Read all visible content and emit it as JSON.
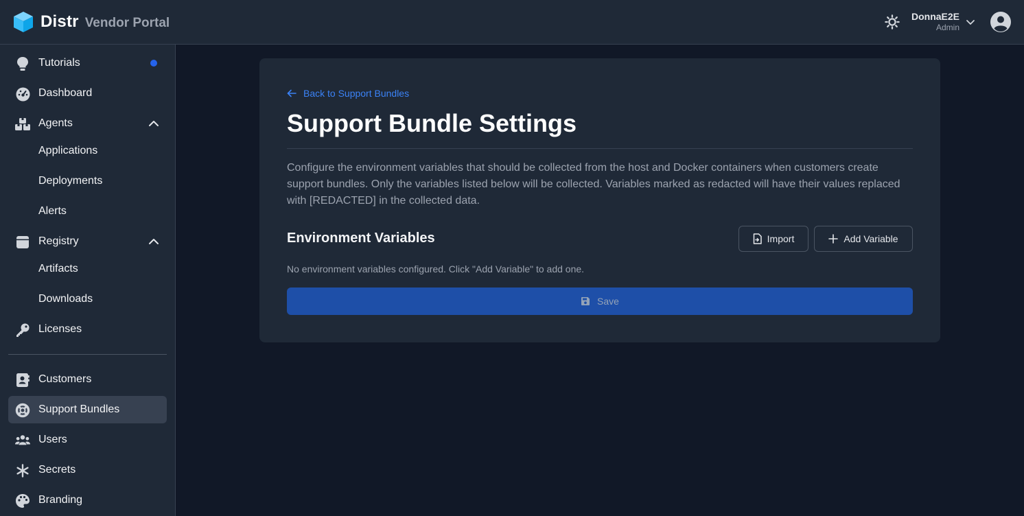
{
  "header": {
    "brand_name": "Distr",
    "brand_sub": "Vendor Portal",
    "user_name": "DonnaE2E",
    "user_role": "Admin"
  },
  "sidebar": {
    "items": [
      {
        "label": "Tutorials",
        "icon": "lightbulb-icon"
      },
      {
        "label": "Dashboard",
        "icon": "dashboard-icon"
      },
      {
        "label": "Agents",
        "icon": "agents-icon"
      },
      {
        "label": "Applications"
      },
      {
        "label": "Deployments"
      },
      {
        "label": "Alerts"
      },
      {
        "label": "Registry",
        "icon": "registry-icon"
      },
      {
        "label": "Artifacts"
      },
      {
        "label": "Downloads"
      },
      {
        "label": "Licenses",
        "icon": "key-icon"
      },
      {
        "label": "Customers",
        "icon": "contact-card-icon"
      },
      {
        "label": "Support Bundles",
        "icon": "lifebuoy-icon"
      },
      {
        "label": "Users",
        "icon": "users-icon"
      },
      {
        "label": "Secrets",
        "icon": "asterisk-icon"
      },
      {
        "label": "Branding",
        "icon": "palette-icon"
      }
    ]
  },
  "main": {
    "back_link": "Back to Support Bundles",
    "title": "Support Bundle Settings",
    "description": "Configure the environment variables that should be collected from the host and Docker containers when customers create support bundles. Only the variables listed below will be collected. Variables marked as redacted will have their values replaced with [REDACTED] in the collected data.",
    "section_title": "Environment Variables",
    "import_label": "Import",
    "add_label": "Add Variable",
    "empty_text": "No environment variables configured. Click \"Add Variable\" to add one.",
    "save_label": "Save"
  },
  "colors": {
    "background": "#111827",
    "panel": "#1f2937",
    "accent": "#3b82f6",
    "save_button": "#1e4fa8",
    "notification_dot": "#2563eb"
  }
}
